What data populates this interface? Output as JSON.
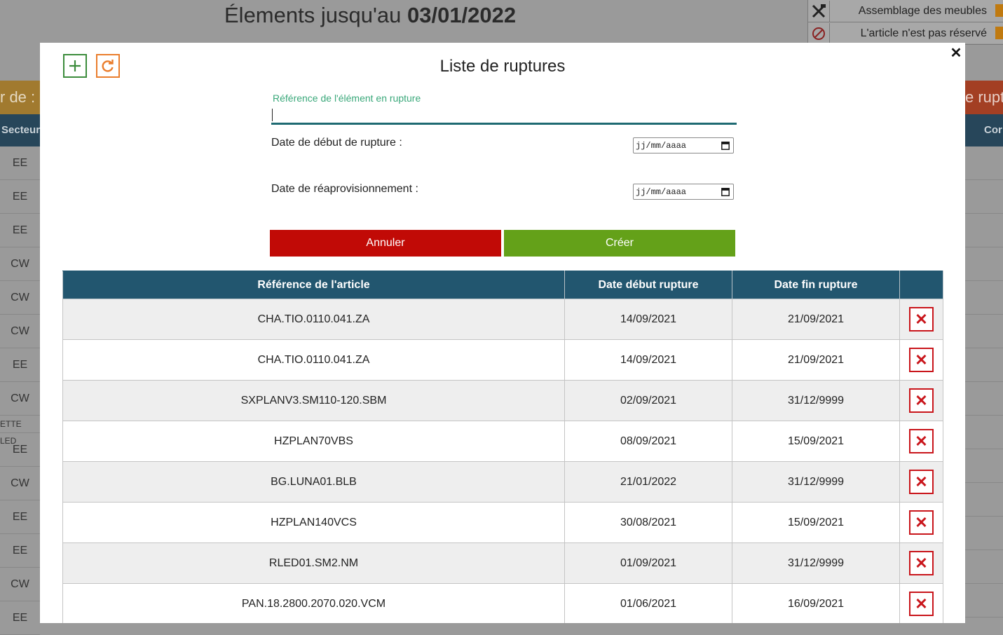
{
  "background": {
    "title_prefix": "Élements jusqu'au",
    "title_date": "03/01/2022",
    "legend": [
      {
        "icon": "tools-icon",
        "label": "Assemblage des meubles"
      },
      {
        "icon": "not-reserved-icon",
        "label": "L'article n'est pas réservé"
      }
    ],
    "banner_left": "r de :",
    "banner_right": "e rupt",
    "header_left": "Secteur",
    "header_right": "Cor",
    "sectors": [
      "EE",
      "EE",
      "EE",
      "CW",
      "CW",
      "CW",
      "EE",
      "CW",
      "ETTE LED",
      "EE",
      "CW",
      "EE",
      "EE",
      "CW",
      "EE"
    ]
  },
  "modal": {
    "title": "Liste de ruptures",
    "add_icon": "plus-icon",
    "refresh_icon": "refresh-icon",
    "close_label": "✕",
    "form": {
      "reference_label": "Référence de l'élément en rupture",
      "reference_value": "",
      "start_label": "Date de début de rupture :",
      "start_placeholder": "jj/mm/aaaa",
      "restock_label": "Date de réaprovisionnement :",
      "restock_placeholder": "jj/mm/aaaa"
    },
    "buttons": {
      "cancel": "Annuler",
      "create": "Créer"
    },
    "colors": {
      "header": "#22566f",
      "cancel": "#c10a06",
      "create": "#64a119",
      "delete": "#c9151b"
    },
    "table": {
      "columns": [
        "Référence de l'article",
        "Date début rupture",
        "Date fin rupture",
        ""
      ],
      "delete_label": "✕",
      "rows": [
        {
          "ref": "CHA.TIO.0110.041.ZA",
          "start": "14/09/2021",
          "end": "21/09/2021"
        },
        {
          "ref": "CHA.TIO.0110.041.ZA",
          "start": "14/09/2021",
          "end": "21/09/2021"
        },
        {
          "ref": "SXPLANV3.SM110-120.SBM",
          "start": "02/09/2021",
          "end": "31/12/9999"
        },
        {
          "ref": "HZPLAN70VBS",
          "start": "08/09/2021",
          "end": "15/09/2021"
        },
        {
          "ref": "BG.LUNA01.BLB",
          "start": "21/01/2022",
          "end": "31/12/9999"
        },
        {
          "ref": "HZPLAN140VCS",
          "start": "30/08/2021",
          "end": "15/09/2021"
        },
        {
          "ref": "RLED01.SM2.NM",
          "start": "01/09/2021",
          "end": "31/12/9999"
        },
        {
          "ref": "PAN.18.2800.2070.020.VCM",
          "start": "01/06/2021",
          "end": "16/09/2021"
        }
      ]
    }
  }
}
